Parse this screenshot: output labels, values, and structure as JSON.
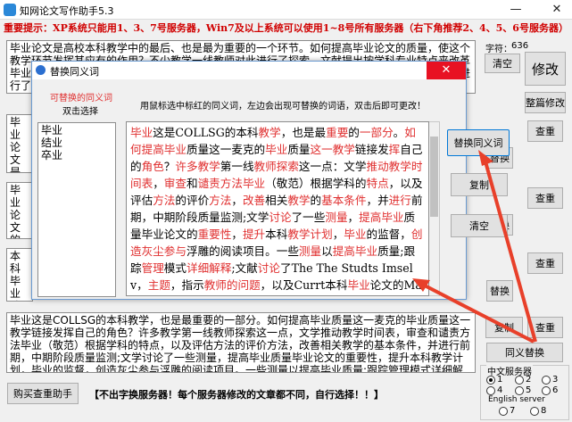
{
  "app": {
    "title": "知网论文写作助手5.3",
    "notice": "重要提示：XP系统只能用1、3、7号服务器，Win7及以上系统可以使用1~8号所有服务器（右下角推荐2、4、5、6号服务器）"
  },
  "main": {
    "top_text": "毕业论文是高校本科教学中的最后、也是最为重要的一个环节。如何提高毕业论文的质量，使这个教学环节发挥其应有的作用？不少教学一线教师对此进行了探索，文献提出按学科专业特点来改革毕业论文选题，文献对本科毕业论文指导与管理进行了探讨，文献结合现有工作情况对毕业论文进行了分析。",
    "mid1_text": "毕业论文是检验学生综合素质和实践能力的重要手段，如何审查毕业论文的质量，从毕业论文选题，撰写，答辩等",
    "mid2_text": "毕业论文的质量是高校本科教学的一面镜子，一些学科也开始对此",
    "mid3_text": "本科毕业论文的写作和指导工作有很多方面，从质量监控的角度，毕业论文是检验教学质量的重要标准",
    "bottom_text": "毕业这是COLLSG的本科教学，也是最重要的一部分。如何提高毕业质量这一麦克的毕业质量这一教学链接发挥自己的角色？许多教学第一线教师探索这一点，文学推动教学时间表，审查和谴责方法毕业（敬范）根据学科的特点，以及评估方法的评价方法，改善相关教学的基本条件，并进行前期，中期阶段质量监测;文学讨论了一些测量，提高毕业质量毕业论文的重要性，提升本科教学计划，毕业的监督，创造灰尘参与浮雕的阅读项目。一些测量以提高毕业质量;跟踪管理模式详细解释;",
    "char_count_label": "字符：",
    "char_count": "636",
    "footer": "【不出字换服务器！每个服务器修改的文章都不同，自行选择！！】"
  },
  "buttons": {
    "clear": "清空",
    "modify": "修改",
    "polish": "整篇修改",
    "check1": "查重",
    "replace1": "替换",
    "check2": "查重",
    "check3": "查重",
    "replace2": "替换",
    "replace3": "替换",
    "copy": "复制",
    "check4": "查重",
    "synonym_replace": "同义替换",
    "buy": "购买查重助手"
  },
  "servers": {
    "cn_label": "中文服务器",
    "en_label": "English server",
    "options": [
      "1",
      "2",
      "3",
      "4",
      "5",
      "6",
      "7",
      "8"
    ],
    "selected": "1"
  },
  "dialog": {
    "title": "替换同义词",
    "left_header": "可替换的同义词",
    "left_sub": "双击选择",
    "hint": "用鼠标选中标红的同义词，左边会出现可替换的词语，双击后即可更改！",
    "synonyms": [
      "毕业",
      "结业",
      "卒业"
    ],
    "btn_replace": "替换同义词",
    "btn_copy": "复制",
    "btn_clear": "清空",
    "segments": [
      {
        "t": "毕业",
        "r": true
      },
      {
        "t": "这是COLLSG的本科",
        "r": false
      },
      {
        "t": "教学",
        "r": true
      },
      {
        "t": "，也是最",
        "r": false
      },
      {
        "t": "重要",
        "r": true
      },
      {
        "t": "的",
        "r": false
      },
      {
        "t": "一部分",
        "r": true
      },
      {
        "t": "。",
        "r": false
      },
      {
        "t": "如何",
        "r": true
      },
      {
        "t": "提高",
        "r": true
      },
      {
        "t": "毕业",
        "r": true
      },
      {
        "t": "质量这一麦克的",
        "r": false
      },
      {
        "t": "毕业",
        "r": true
      },
      {
        "t": "质量",
        "r": false
      },
      {
        "t": "这一教学",
        "r": true
      },
      {
        "t": "链接发",
        "r": false
      },
      {
        "t": "挥",
        "r": true
      },
      {
        "t": "自己的",
        "r": false
      },
      {
        "t": "角色",
        "r": true
      },
      {
        "t": "？",
        "r": false
      },
      {
        "t": "许多教学",
        "r": true
      },
      {
        "t": "第一线",
        "r": false
      },
      {
        "t": "教师",
        "r": true
      },
      {
        "t": "探索",
        "r": true
      },
      {
        "t": "这一点：文学",
        "r": false
      },
      {
        "t": "推动",
        "r": true
      },
      {
        "t": "教学时间表",
        "r": true
      },
      {
        "t": "，",
        "r": false
      },
      {
        "t": "审查",
        "r": true
      },
      {
        "t": "和",
        "r": false
      },
      {
        "t": "谴责方法",
        "r": true
      },
      {
        "t": "毕业",
        "r": true
      },
      {
        "t": "（敬范）根据学",
        "r": false
      },
      {
        "t": "科的",
        "r": false
      },
      {
        "t": "特点",
        "r": true
      },
      {
        "t": "，以及评估",
        "r": false
      },
      {
        "t": "方法",
        "r": true
      },
      {
        "t": "的评价",
        "r": false
      },
      {
        "t": "方法",
        "r": true
      },
      {
        "t": "，",
        "r": false
      },
      {
        "t": "改善",
        "r": true
      },
      {
        "t": "相关",
        "r": false
      },
      {
        "t": "教学",
        "r": true
      },
      {
        "t": "的",
        "r": false
      },
      {
        "t": "基本条件",
        "r": true
      },
      {
        "t": "，并",
        "r": false
      },
      {
        "t": "进行",
        "r": true
      },
      {
        "t": "前期，中期阶段质量监测;文学",
        "r": false
      },
      {
        "t": "讨论",
        "r": true
      },
      {
        "t": "了一些",
        "r": false
      },
      {
        "t": "测量",
        "r": true
      },
      {
        "t": "，",
        "r": false
      },
      {
        "t": "提高毕业",
        "r": true
      },
      {
        "t": "质量毕业论文的",
        "r": false
      },
      {
        "t": "重要性",
        "r": true
      },
      {
        "t": "，",
        "r": false
      },
      {
        "t": "提升",
        "r": true
      },
      {
        "t": "本",
        "r": false
      },
      {
        "t": "科",
        "r": false
      },
      {
        "t": "教学计划",
        "r": true
      },
      {
        "t": "，",
        "r": false
      },
      {
        "t": "毕业",
        "r": true
      },
      {
        "t": "的监督，",
        "r": false
      },
      {
        "t": "创造灰尘参与",
        "r": true
      },
      {
        "t": "浮雕的阅读项",
        "r": false
      },
      {
        "t": "目。一些",
        "r": false
      },
      {
        "t": "测量",
        "r": true
      },
      {
        "t": "以",
        "r": false
      },
      {
        "t": "提高毕业",
        "r": true
      },
      {
        "t": "质量;跟踪",
        "r": false
      },
      {
        "t": "管理",
        "r": true
      },
      {
        "t": "模式",
        "r": false
      },
      {
        "t": "详细解",
        "r": true
      },
      {
        "t": "释",
        "r": true
      },
      {
        "t": ";文献",
        "r": false
      },
      {
        "t": "讨论",
        "r": true
      },
      {
        "t": "了The The Studts Imselv，",
        "r": false
      },
      {
        "t": "主题",
        "r": true
      },
      {
        "t": "，指示",
        "r": false
      },
      {
        "t": "教师的问题",
        "r": true
      },
      {
        "t": "，以及Currt本科",
        "r": false
      },
      {
        "t": "毕业",
        "r": true
      },
      {
        "t": "论文的Managemit:文",
        "r": false
      }
    ]
  }
}
